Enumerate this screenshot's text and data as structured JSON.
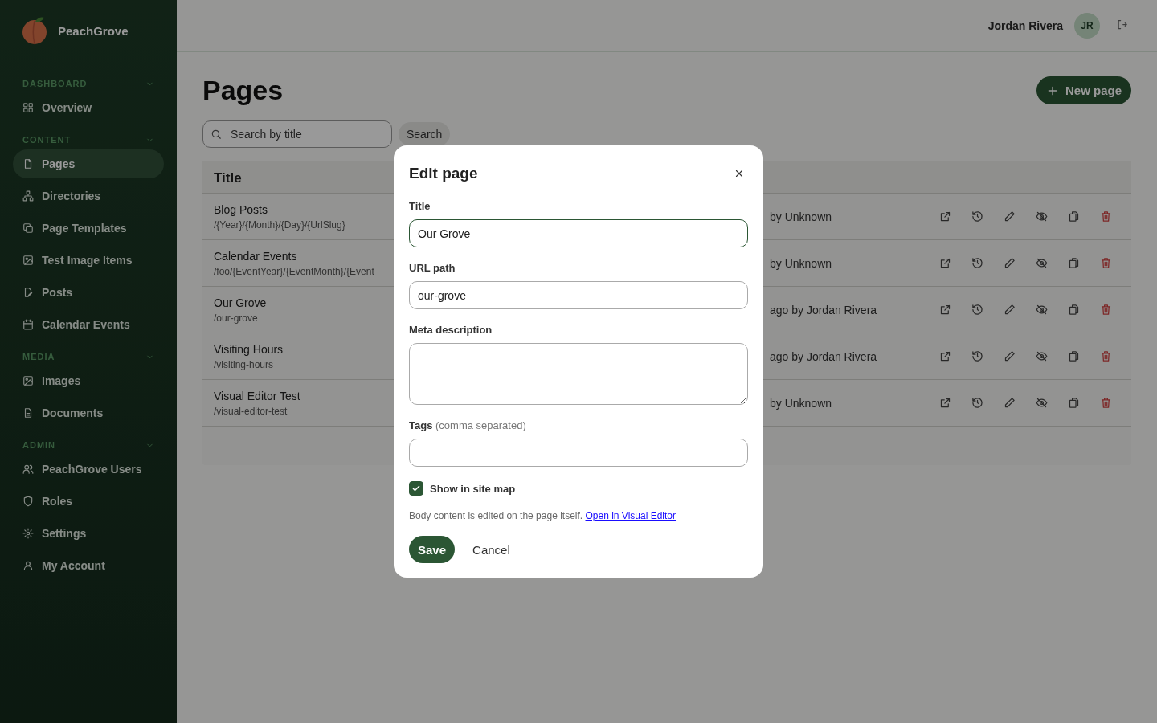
{
  "brand": {
    "name": "PeachGrove"
  },
  "sidebar": {
    "sections": [
      {
        "label": "DASHBOARD",
        "items": [
          {
            "label": "Overview",
            "selected": false
          }
        ]
      },
      {
        "label": "CONTENT",
        "items": [
          {
            "label": "Pages",
            "selected": true
          },
          {
            "label": "Directories",
            "selected": false
          },
          {
            "label": "Page Templates",
            "selected": false
          },
          {
            "label": "Test Image Items",
            "selected": false
          },
          {
            "label": "Posts",
            "selected": false
          },
          {
            "label": "Calendar Events",
            "selected": false
          }
        ]
      },
      {
        "label": "MEDIA",
        "items": [
          {
            "label": "Images",
            "selected": false
          },
          {
            "label": "Documents",
            "selected": false
          }
        ]
      },
      {
        "label": "ADMIN",
        "items": [
          {
            "label": "PeachGrove Users",
            "selected": false
          },
          {
            "label": "Roles",
            "selected": false
          },
          {
            "label": "Settings",
            "selected": false
          },
          {
            "label": "My Account",
            "selected": false
          }
        ]
      }
    ]
  },
  "topbar": {
    "user_name": "Jordan Rivera",
    "avatar_initials": "JR"
  },
  "page": {
    "title": "Pages",
    "new_button": "New page"
  },
  "search": {
    "placeholder": "Search by title",
    "button": "Search"
  },
  "table": {
    "columns": [
      "Title"
    ],
    "rows": [
      {
        "title": "Blog Posts",
        "path": "/{Year}/{Month}/{Day}/{UrlSlug}",
        "updated": "by Unknown"
      },
      {
        "title": "Calendar Events",
        "path": "/foo/{EventYear}/{EventMonth}/{Event",
        "updated": "by Unknown"
      },
      {
        "title": "Our Grove",
        "path": "/our-grove",
        "updated": "ago by Jordan Rivera"
      },
      {
        "title": "Visiting Hours",
        "path": "/visiting-hours",
        "updated": "ago by Jordan Rivera"
      },
      {
        "title": "Visual Editor Test",
        "path": "/visual-editor-test",
        "updated": "by Unknown"
      }
    ]
  },
  "dialog": {
    "title": "Edit page",
    "fields": [
      {
        "kind": "input",
        "label": "Title",
        "value": "Our Grove",
        "focused": true
      },
      {
        "kind": "input",
        "label": "URL path",
        "value": "our-grove",
        "focused": false
      },
      {
        "kind": "textarea",
        "label": "Meta description",
        "focused": false
      },
      {
        "kind": "input",
        "label": "Tags",
        "hint": "(comma separated)",
        "focused": false
      }
    ],
    "checkbox": {
      "label": "Show in site map",
      "checked": true
    },
    "note": "Body content is edited on the page itself.",
    "link": "Open in Visual Editor",
    "save": "Save",
    "cancel": "Cancel"
  }
}
